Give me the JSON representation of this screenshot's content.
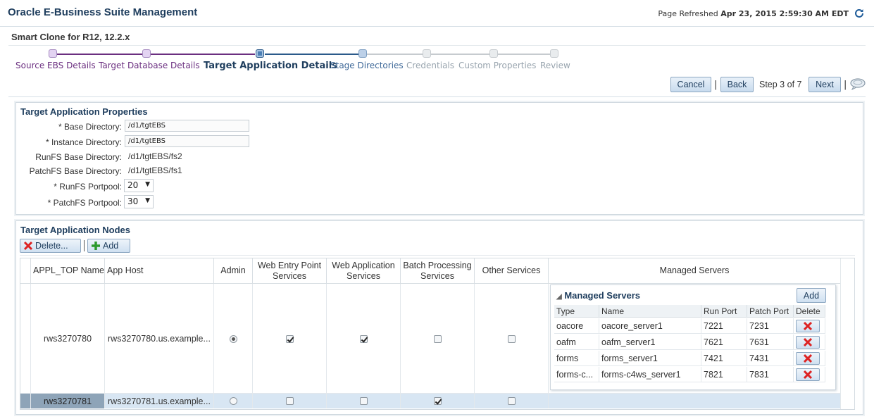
{
  "header": {
    "app_title": "Oracle E-Business Suite Management",
    "refresh_label": "Page Refreshed",
    "refresh_time": "Apr 23, 2015 2:59:30 AM EDT",
    "refresh_icon": "refresh-icon"
  },
  "page_title": "Smart Clone for R12, 12.2.x",
  "train": [
    {
      "label": "Source EBS Details",
      "state": "visited"
    },
    {
      "label": "Target Database Details",
      "state": "visited"
    },
    {
      "label": "Target Application Details",
      "state": "current"
    },
    {
      "label": "Stage Directories",
      "state": "next"
    },
    {
      "label": "Credentials",
      "state": "disabled"
    },
    {
      "label": "Custom Properties",
      "state": "disabled"
    },
    {
      "label": "Review",
      "state": "disabled"
    }
  ],
  "nav": {
    "cancel": "Cancel",
    "back": "Back",
    "step_text": "Step 3 of 7",
    "next": "Next",
    "separator": "|"
  },
  "properties": {
    "title": "Target Application Properties",
    "base_dir_label": "* Base Directory:",
    "base_dir_value": "/d1/tgtEBS",
    "instance_dir_label": "* Instance Directory:",
    "instance_dir_value": "/d1/tgtEBS",
    "runfs_base_label": "RunFS Base Directory:",
    "runfs_base_value": "/d1/tgtEBS/fs2",
    "patchfs_base_label": "PatchFS Base Directory:",
    "patchfs_base_value": "/d1/tgtEBS/fs1",
    "runfs_portpool_label": "* RunFS Portpool:",
    "runfs_portpool_value": "20",
    "patchfs_portpool_label": "* PatchFS Portpool:",
    "patchfs_portpool_value": "30"
  },
  "nodes": {
    "title": "Target Application Nodes",
    "delete_label": "Delete...",
    "add_label": "Add",
    "columns": {
      "appl_top": "APPL_TOP Name",
      "app_host": "App Host",
      "admin": "Admin",
      "web_entry": "Web Entry Point Services",
      "web_app": "Web Application Services",
      "batch": "Batch Processing Services",
      "other": "Other Services",
      "managed": "Managed Servers"
    },
    "rows": [
      {
        "appl_top": "rws3270780",
        "app_host": "rws3270780.us.example...",
        "admin": true,
        "web_entry": true,
        "web_app": true,
        "batch": false,
        "other": false
      },
      {
        "appl_top": "rws3270781",
        "app_host": "rws3270781.us.example...",
        "admin": false,
        "web_entry": false,
        "web_app": false,
        "batch": true,
        "other": false
      }
    ],
    "managed_servers": {
      "title": "Managed Servers",
      "add_label": "Add",
      "columns": {
        "type": "Type",
        "name": "Name",
        "run_port": "Run Port",
        "patch_port": "Patch Port",
        "delete": "Delete"
      },
      "rows": [
        {
          "type": "oacore",
          "name": "oacore_server1",
          "run_port": "7221",
          "patch_port": "7231"
        },
        {
          "type": "oafm",
          "name": "oafm_server1",
          "run_port": "7621",
          "patch_port": "7631"
        },
        {
          "type": "forms",
          "name": "forms_server1",
          "run_port": "7421",
          "patch_port": "7431"
        },
        {
          "type": "forms-c...",
          "name": "forms-c4ws_server1",
          "run_port": "7821",
          "patch_port": "7831"
        }
      ]
    }
  }
}
